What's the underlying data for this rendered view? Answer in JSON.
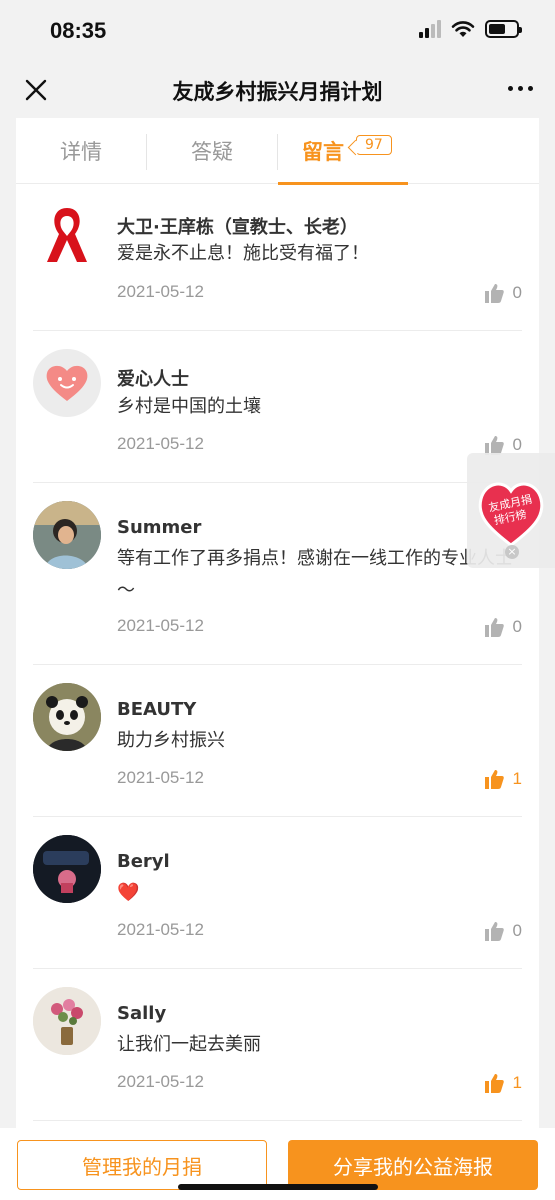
{
  "status_bar": {
    "time": "08:35"
  },
  "nav": {
    "title": "友成乡村振兴月捐计划"
  },
  "tabs": [
    {
      "label": "详情"
    },
    {
      "label": "答疑"
    },
    {
      "label": "留言",
      "badge": "97"
    }
  ],
  "comments": [
    {
      "name": "大卫·王庠栋（宣教士、长老）",
      "text": "爱是永不止息！施比受有福了！",
      "date": "2021-05-12",
      "likes": "0",
      "liked": false,
      "avatar": "red-ribbon"
    },
    {
      "name": "爱心人士",
      "text": "乡村是中国的土壤",
      "date": "2021-05-12",
      "likes": "0",
      "liked": false,
      "avatar": "heart"
    },
    {
      "name": "Summer",
      "text": "等有工作了再多捐点！感谢在一线工作的专业人士～",
      "date": "2021-05-12",
      "likes": "0",
      "liked": false,
      "avatar": "photo"
    },
    {
      "name": "BEAUTY",
      "text": "助力乡村振兴",
      "date": "2021-05-12",
      "likes": "1",
      "liked": true,
      "avatar": "panda"
    },
    {
      "name": "Beryl",
      "text": "❤️",
      "date": "2021-05-12",
      "likes": "0",
      "liked": false,
      "avatar": "dark-photo"
    },
    {
      "name": "Sally",
      "text": "让我们一起去美丽",
      "date": "2021-05-12",
      "likes": "1",
      "liked": true,
      "avatar": "flowers"
    }
  ],
  "float_widget": {
    "label_line1": "友成月捐",
    "label_line2": "排行榜"
  },
  "bottom": {
    "manage_label": "管理我的月捐",
    "share_label": "分享我的公益海报"
  },
  "colors": {
    "accent": "#f7931e",
    "muted": "#999999"
  }
}
